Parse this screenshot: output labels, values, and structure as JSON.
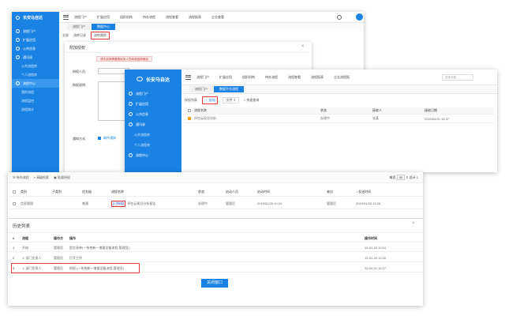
{
  "brand": {
    "name": "长安马自达"
  },
  "colors": {
    "accent": "#1a82e2",
    "highlight": "#e53935"
  },
  "back_window": {
    "menu": [
      "流程门户",
      "扩展应用",
      "组织机构",
      "待办流程",
      "流程查看",
      "流程报表",
      "企业查看"
    ],
    "tabs": [
      "流程门户",
      "数据中心"
    ],
    "toolbar": [
      "全部",
      "流转记录",
      "流转跟踪"
    ],
    "dialog": {
      "title": "附加授权",
      "hint": "请先选择需要授权的人员和原因再确定",
      "fields": {
        "person": "授权人员:",
        "reason": "授权说明:",
        "method": "通知方式:"
      },
      "option": "邮件通知"
    },
    "sidebar": [
      "流程门户",
      "扩展应用",
      "公共信息",
      "通讯录",
      "流程中心",
      "公共流程库",
      "个人流程库",
      "我的流程",
      "流程监控",
      "流程统计"
    ]
  },
  "mid_window": {
    "menu": [
      "流程门户",
      "扩展应用",
      "组织机构",
      "待办流程",
      "流程查看",
      "流程报表",
      "企业流程报"
    ],
    "search_hint": "搜索流程",
    "tabs": [
      "流程门户",
      "数据平台流程"
    ],
    "sidebar": [
      "流程门户",
      "扩展应用",
      "公共信息",
      "通讯录",
      "公共流程库",
      "个人流程库",
      "流程中心"
    ],
    "toolbar": {
      "list": "授权列表",
      "approve": "批准",
      "type_label": "文件",
      "search": "快速查询"
    },
    "headers": [
      "流程名称",
      "状态",
      "接收人",
      "接收日期"
    ],
    "row": {
      "name": "评估云现况分析",
      "status": "办理中",
      "person": "张某",
      "date": "2020/04/01 16:37"
    }
  },
  "front_window": {
    "toolbar": {
      "pending": "待办流程",
      "advanced": "高级检索",
      "batch": "批量授权"
    },
    "pager": {
      "per_page_label": "每页",
      "per_page": "30",
      "total_label": "总计",
      "total": "1"
    },
    "headers": [
      "类别",
      "子类别",
      "优先级",
      "流程名称",
      "状态",
      "启动人员",
      "启动时间",
      "来自",
      "发送时间"
    ],
    "row": {
      "category": "信息管理",
      "priority": "普通",
      "tag": "[已授权]",
      "name": "评估云现况分析报告",
      "status": "办理中",
      "starter": "管理员",
      "start_time": "2019/01/25 10:24",
      "from": "管理员",
      "send_time": "2019/01/25 10:28"
    },
    "history": {
      "title": "历史列表",
      "headers": {
        "num": "#",
        "node": "流程",
        "op": "操作方",
        "action": "操作",
        "time": "操作时间"
      },
      "rows": [
        {
          "num": "1",
          "node": "开始",
          "op": "管理员",
          "action": "提交表单(一系统新一增量设备流程-管理员)",
          "time": "19-02-25 10:24"
        },
        {
          "num": "2",
          "node": "1. 部门负责人",
          "op": "管理员",
          "action": "打开工作",
          "time": "19-02-25 10:26"
        },
        {
          "num": "3",
          "node": "1. 部门负责人",
          "op": "管理员",
          "action": "授权 (一系统新一增量设备流程-管理员)",
          "time": "20-04-01 16:37"
        }
      ]
    },
    "close_button": "关闭窗口"
  }
}
